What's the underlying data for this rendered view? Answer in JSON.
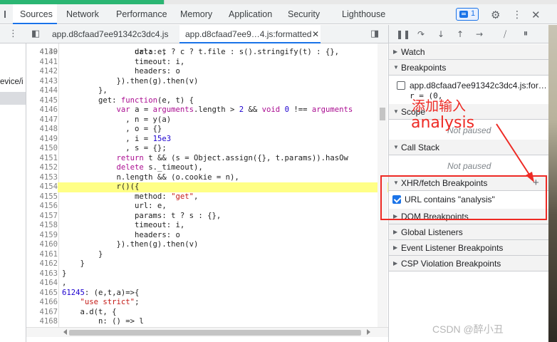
{
  "tabs": {
    "items": [
      {
        "label": "Sources"
      },
      {
        "label": "Network"
      },
      {
        "label": "Performance"
      },
      {
        "label": "Memory"
      },
      {
        "label": "Application"
      },
      {
        "label": "Security"
      },
      {
        "label": "Lighthouse"
      }
    ],
    "badge_count": "1"
  },
  "file_tabs": [
    {
      "label": "app.d8cfaad7ee91342c3dc4.js"
    },
    {
      "label": "app.d8cfaad7ee9…4.js:formatted"
    }
  ],
  "navigator": {
    "partial_text": "evice/i"
  },
  "code": {
    "lines": [
      {
        "num": "4140",
        "text": "                data: t ? c ? t.file : s().stringify(t) : {},"
      },
      {
        "num": "4141",
        "text": "                timeout: i,"
      },
      {
        "num": "4142",
        "text": "                headers: o"
      },
      {
        "num": "4143",
        "text": "            }).then(g).then(v)"
      },
      {
        "num": "4144",
        "text": "        },"
      },
      {
        "num": "4145",
        "text": "        get: function(e, t) {"
      },
      {
        "num": "4146",
        "text": "            var a = arguments.length > 2 && void 0 !== arguments"
      },
      {
        "num": "4147",
        "text": "              , n = y(a)"
      },
      {
        "num": "4148",
        "text": "              , o = {}"
      },
      {
        "num": "4149",
        "text": "              , i = 15e3"
      },
      {
        "num": "4150",
        "text": "              , s = {};"
      },
      {
        "num": "4151",
        "text": "            return t && (s = Object.assign({}, t.params)).hasOw"
      },
      {
        "num": "4152",
        "text": "            delete s._timeout),"
      },
      {
        "num": "4153",
        "text": "            n.length && (o.cookie = n),"
      },
      {
        "num": "4154",
        "text": "            r()({"
      },
      {
        "num": "4155",
        "text": "                method: \"get\","
      },
      {
        "num": "4156",
        "text": "                url: e,"
      },
      {
        "num": "4157",
        "text": "                params: t ? s : {},"
      },
      {
        "num": "4158",
        "text": "                timeout: i,"
      },
      {
        "num": "4159",
        "text": "                headers: o"
      },
      {
        "num": "4160",
        "text": "            }).then(g).then(v)"
      },
      {
        "num": "4161",
        "text": "        }"
      },
      {
        "num": "4162",
        "text": "    }"
      },
      {
        "num": "4163",
        "text": "}"
      },
      {
        "num": "4164",
        "text": ","
      },
      {
        "num": "4165",
        "text": "61245: (e,t,a)=>{"
      },
      {
        "num": "4166",
        "text": "    \"use strict\";"
      },
      {
        "num": "4167",
        "text": "    a.d(t, {"
      },
      {
        "num": "4168",
        "text": "        n: () => l"
      }
    ],
    "partial_top": "                url: e,",
    "highlight_line": "4154"
  },
  "sidebar": {
    "watch": "Watch",
    "breakpoints": "Breakpoints",
    "breakpoint_item": "app.d8cfaad7ee91342c3dc4.js:for…",
    "breakpoint_sub": "r = (0,",
    "scope": "Scope",
    "not_paused_1": "Not paused",
    "call_stack": "Call Stack",
    "not_paused_2": "Not paused",
    "xhr": "XHR/fetch Breakpoints",
    "xhr_item": "URL contains \"analysis\"",
    "dom": "DOM Breakpoints",
    "global": "Global Listeners",
    "event": "Event Listener Breakpoints",
    "csp": "CSP Violation Breakpoints"
  },
  "annotation": {
    "line1": "添加输入",
    "line2": "analysis",
    "color": "#ee2a24"
  },
  "watermark": "CSDN @醉小丑"
}
